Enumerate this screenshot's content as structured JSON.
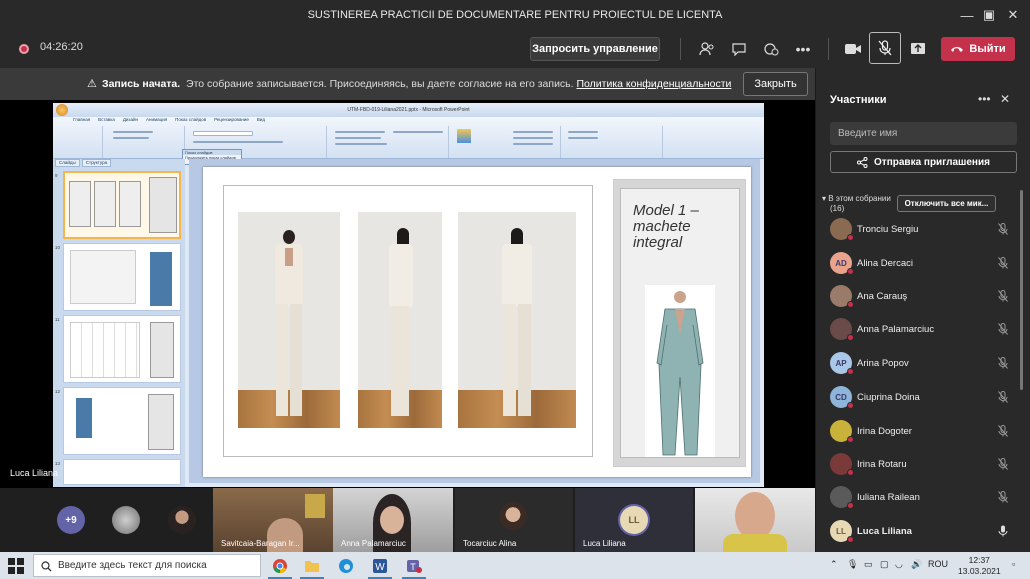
{
  "window": {
    "title": "SUSTINEREA PRACTICII DE DOCUMENTARE PENTRU PROIECTUL DE LICENTA"
  },
  "toolbar": {
    "timer": "04:26:20",
    "request_control": "Запросить управление",
    "leave": "Выйти"
  },
  "banner": {
    "heading": "Запись начата.",
    "text": "Это собрание записывается. Присоединяясь, вы даете согласие на его запись.",
    "link": "Политика конфиденциальности",
    "close": "Закрыть"
  },
  "presentation": {
    "app_title": "UTM-FBD-019-Liliana2021.pptx - Microsoft PowerPoint",
    "ribbon_tabs": [
      "Главная",
      "Вставка",
      "Дизайн",
      "Анимация",
      "Показ слайдов",
      "Рецензирование",
      "Вид"
    ],
    "panel_tabs": [
      "Слайды",
      "Структура"
    ],
    "popup_title": "Показ слайдов",
    "popup_item": "Продолжить показ слайдов",
    "thumb_numbers": [
      "9",
      "10",
      "11",
      "12",
      "13"
    ],
    "slide_side_text": "Model 1 – machete integral",
    "presenter_name": "Luca Liliana"
  },
  "strip": {
    "more_count": "+9",
    "tiles": [
      {
        "name": "Savitcaia-Baragan Ir..."
      },
      {
        "name": "Anna Palamarciuc"
      },
      {
        "name": "Tocarciuc Alina"
      },
      {
        "name": "Luca Liliana",
        "initials": "LL"
      },
      {
        "name": ""
      }
    ]
  },
  "participants": {
    "title": "Участники",
    "search_placeholder": "Введите имя",
    "invite": "Отправка приглашения",
    "section": "В этом собрании",
    "section_count": "(16)",
    "mute_all": "Отключить все мик...",
    "people": [
      {
        "name": "Tronciu Sergiu",
        "initials": "",
        "color": "#8a6a50"
      },
      {
        "name": "Alina Dercaci",
        "initials": "AD",
        "color": "#e9a38d"
      },
      {
        "name": "Ana Carauş",
        "initials": "",
        "color": "#9a7b6a"
      },
      {
        "name": "Anna Palamarciuc",
        "initials": "",
        "color": "#6b4a4a"
      },
      {
        "name": "Arina Popov",
        "initials": "AP",
        "color": "#a9c8e8"
      },
      {
        "name": "Ciuprina Doina",
        "initials": "CD",
        "color": "#8fb4d9"
      },
      {
        "name": "Irina Dogoter",
        "initials": "",
        "color": "#c9b23a"
      },
      {
        "name": "Irina Rotaru",
        "initials": "",
        "color": "#7a3a3a"
      },
      {
        "name": "Iuliana Railean",
        "initials": "",
        "color": "#5a5a5a"
      },
      {
        "name": "Luca Liliana",
        "initials": "LL",
        "color": "#e8d9b5"
      }
    ]
  },
  "taskbar": {
    "search_placeholder": "Введите здесь текст для поиска",
    "lang": "ROU",
    "time": "12:37",
    "date": "13.03.2021"
  },
  "colors": {
    "accent": "#6264a7",
    "leave": "#c4314b",
    "panel": "#292929"
  }
}
